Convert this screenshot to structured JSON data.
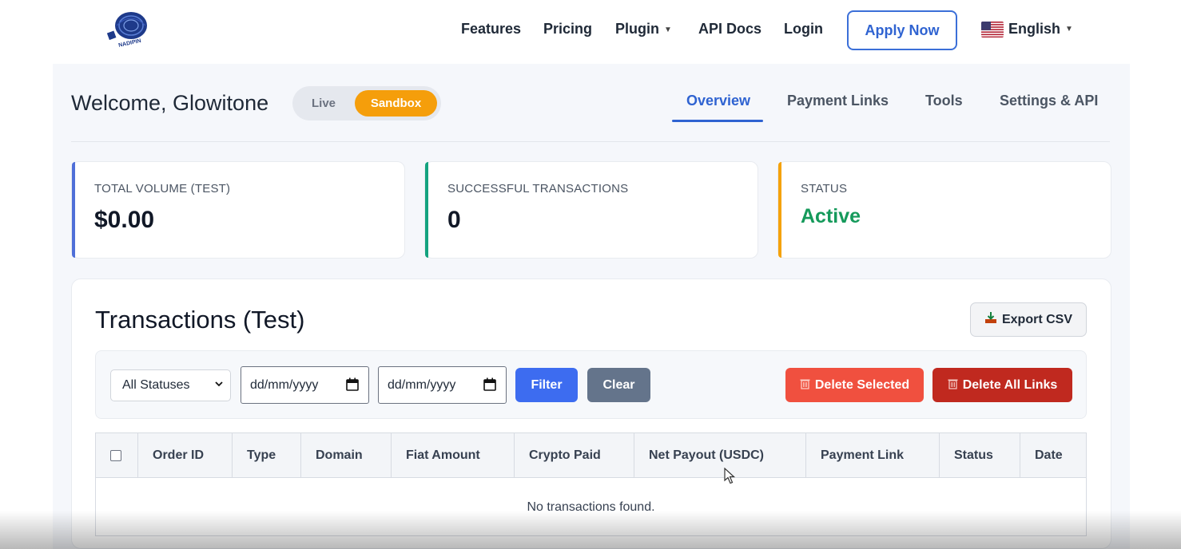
{
  "nav": {
    "logo_text": "NADIPIN",
    "items": [
      {
        "label": "Features"
      },
      {
        "label": "Pricing"
      },
      {
        "label": "Plugin"
      },
      {
        "label": "API Docs"
      },
      {
        "label": "Login"
      }
    ],
    "apply_label": "Apply Now",
    "language": "English"
  },
  "header": {
    "welcome": "Welcome, Glowitone",
    "mode_live": "Live",
    "mode_sandbox": "Sandbox",
    "active_mode": "Sandbox",
    "tabs": [
      {
        "label": "Overview",
        "active": true
      },
      {
        "label": "Payment Links",
        "active": false
      },
      {
        "label": "Tools",
        "active": false
      },
      {
        "label": "Settings & API",
        "active": false
      }
    ]
  },
  "stats": [
    {
      "label": "TOTAL VOLUME (TEST)",
      "value": "$0.00",
      "accent": "#4f6fd8"
    },
    {
      "label": "SUCCESSFUL TRANSACTIONS",
      "value": "0",
      "accent": "#14a37f"
    },
    {
      "label": "STATUS",
      "value": "Active",
      "accent": "#f5a20b"
    }
  ],
  "transactions": {
    "title": "Transactions (Test)",
    "export_label": "Export CSV",
    "status_select": "All Statuses",
    "date_from_placeholder": "dd/mm/yyyy",
    "date_to_placeholder": "dd/mm/yyyy",
    "filter_label": "Filter",
    "clear_label": "Clear",
    "delete_selected_label": "Delete Selected",
    "delete_all_label": "Delete All Links",
    "columns": [
      "Order ID",
      "Type",
      "Domain",
      "Fiat Amount",
      "Crypto Paid",
      "Net Payout (USDC)",
      "Payment Link",
      "Status",
      "Date"
    ],
    "empty_message": "No transactions found."
  },
  "colors": {
    "primary": "#2f63d1",
    "sandbox": "#f59e0b",
    "filter_btn": "#3d6cf0",
    "clear_btn": "#64748b",
    "delete_selected": "#f0503f",
    "delete_all": "#c0291f",
    "active_status": "#159a5b"
  }
}
